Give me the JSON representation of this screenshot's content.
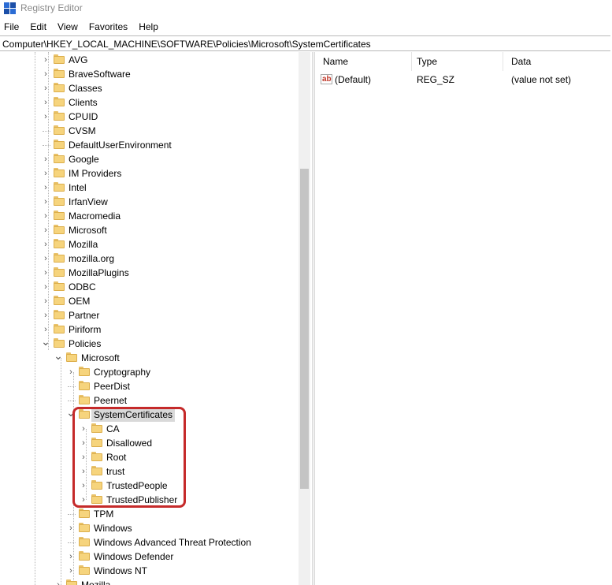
{
  "window": {
    "title": "Registry Editor"
  },
  "menu": [
    {
      "label": "File"
    },
    {
      "label": "Edit"
    },
    {
      "label": "View"
    },
    {
      "label": "Favorites"
    },
    {
      "label": "Help"
    }
  ],
  "address": {
    "path": "Computer\\HKEY_LOCAL_MACHINE\\SOFTWARE\\Policies\\Microsoft\\SystemCertificates"
  },
  "tree": {
    "items": [
      {
        "label": "AVG",
        "level": 1,
        "expandable": true,
        "expanded": false
      },
      {
        "label": "BraveSoftware",
        "level": 1,
        "expandable": true,
        "expanded": false
      },
      {
        "label": "Classes",
        "level": 1,
        "expandable": true,
        "expanded": false
      },
      {
        "label": "Clients",
        "level": 1,
        "expandable": true,
        "expanded": false
      },
      {
        "label": "CPUID",
        "level": 1,
        "expandable": true,
        "expanded": false
      },
      {
        "label": "CVSM",
        "level": 1,
        "expandable": false,
        "expanded": false
      },
      {
        "label": "DefaultUserEnvironment",
        "level": 1,
        "expandable": false,
        "expanded": false
      },
      {
        "label": "Google",
        "level": 1,
        "expandable": true,
        "expanded": false
      },
      {
        "label": "IM Providers",
        "level": 1,
        "expandable": true,
        "expanded": false
      },
      {
        "label": "Intel",
        "level": 1,
        "expandable": true,
        "expanded": false
      },
      {
        "label": "IrfanView",
        "level": 1,
        "expandable": true,
        "expanded": false
      },
      {
        "label": "Macromedia",
        "level": 1,
        "expandable": true,
        "expanded": false
      },
      {
        "label": "Microsoft",
        "level": 1,
        "expandable": true,
        "expanded": false
      },
      {
        "label": "Mozilla",
        "level": 1,
        "expandable": true,
        "expanded": false
      },
      {
        "label": "mozilla.org",
        "level": 1,
        "expandable": true,
        "expanded": false
      },
      {
        "label": "MozillaPlugins",
        "level": 1,
        "expandable": true,
        "expanded": false
      },
      {
        "label": "ODBC",
        "level": 1,
        "expandable": true,
        "expanded": false
      },
      {
        "label": "OEM",
        "level": 1,
        "expandable": true,
        "expanded": false
      },
      {
        "label": "Partner",
        "level": 1,
        "expandable": true,
        "expanded": false
      },
      {
        "label": "Piriform",
        "level": 1,
        "expandable": true,
        "expanded": false
      },
      {
        "label": "Policies",
        "level": 1,
        "expandable": true,
        "expanded": true
      },
      {
        "label": "Microsoft",
        "level": 2,
        "expandable": true,
        "expanded": true
      },
      {
        "label": "Cryptography",
        "level": 3,
        "expandable": true,
        "expanded": false
      },
      {
        "label": "PeerDist",
        "level": 3,
        "expandable": false,
        "expanded": false
      },
      {
        "label": "Peernet",
        "level": 3,
        "expandable": false,
        "expanded": false
      },
      {
        "label": "SystemCertificates",
        "level": 3,
        "expandable": true,
        "expanded": true,
        "selected": true
      },
      {
        "label": "CA",
        "level": 4,
        "expandable": true,
        "expanded": false
      },
      {
        "label": "Disallowed",
        "level": 4,
        "expandable": true,
        "expanded": false
      },
      {
        "label": "Root",
        "level": 4,
        "expandable": true,
        "expanded": false
      },
      {
        "label": "trust",
        "level": 4,
        "expandable": true,
        "expanded": false
      },
      {
        "label": "TrustedPeople",
        "level": 4,
        "expandable": true,
        "expanded": false
      },
      {
        "label": "TrustedPublisher",
        "level": 4,
        "expandable": true,
        "expanded": false
      },
      {
        "label": "TPM",
        "level": 3,
        "expandable": false,
        "expanded": false
      },
      {
        "label": "Windows",
        "level": 3,
        "expandable": true,
        "expanded": false
      },
      {
        "label": "Windows Advanced Threat Protection",
        "level": 3,
        "expandable": false,
        "expanded": false
      },
      {
        "label": "Windows Defender",
        "level": 3,
        "expandable": true,
        "expanded": false
      },
      {
        "label": "Windows NT",
        "level": 3,
        "expandable": true,
        "expanded": false
      },
      {
        "label": "Mozilla",
        "level": 2,
        "expandable": true,
        "expanded": false
      }
    ]
  },
  "values": {
    "columns": [
      {
        "label": "Name"
      },
      {
        "label": "Type"
      },
      {
        "label": "Data"
      }
    ],
    "rows": [
      {
        "name": "(Default)",
        "type": "REG_SZ",
        "data": "(value not set)",
        "icon": "string-value-icon"
      }
    ]
  },
  "scrollbar": {
    "position_fraction": 0.3,
    "visible_fraction": 0.7
  },
  "colors": {
    "highlight_box": "#c52a2a",
    "selection": "#d9d9d9",
    "folder": "#f6d47d"
  }
}
